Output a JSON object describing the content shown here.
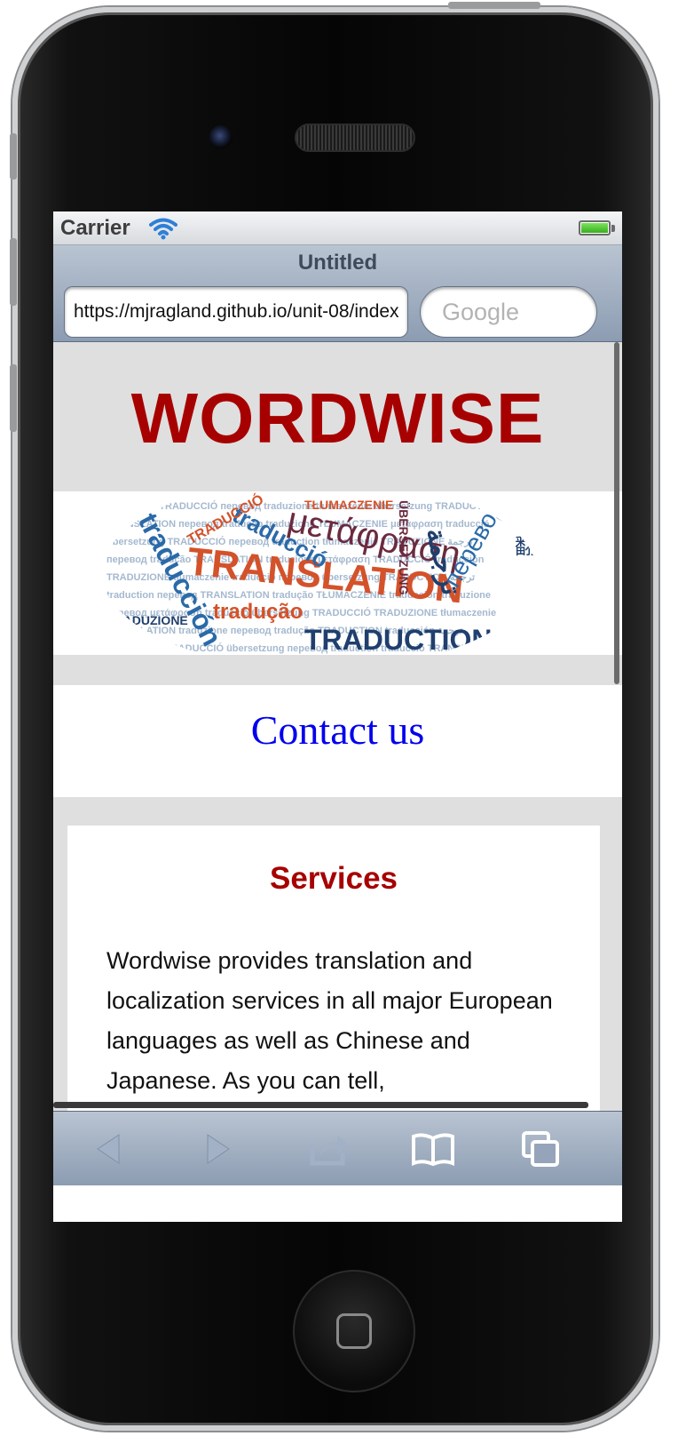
{
  "status": {
    "carrier": "Carrier",
    "battery_level": 1.0
  },
  "browser": {
    "page_title": "Untitled",
    "url": "https://mjragland.github.io/unit-08/index",
    "search_placeholder": "Google"
  },
  "site": {
    "title": "WORDWISE",
    "hero_words": [
      "TRANSLATION",
      "μετάφραση",
      "TRADUCTION",
      "traducción",
      "перевод",
      "tradução",
      "TŁUMACZENIE",
      "TRADUZIONE",
      "ÜBERSETZUNG",
      "traducció",
      "TRADUCCIÓ",
      "ترجمة",
      "翻"
    ],
    "contact_link": "Contact us",
    "services_heading": "Services",
    "services_text": "Wordwise provides translation and localization services in all major European languages as well as Chinese and Japanese. As you can tell,"
  },
  "toolbar": {
    "icons": [
      "back-icon",
      "forward-icon",
      "share-icon",
      "bookmarks-icon",
      "tabs-icon"
    ]
  },
  "colors": {
    "brand_red": "#a70000",
    "link_blue": "#0000ee",
    "band_gray": "#dfdfdf"
  }
}
